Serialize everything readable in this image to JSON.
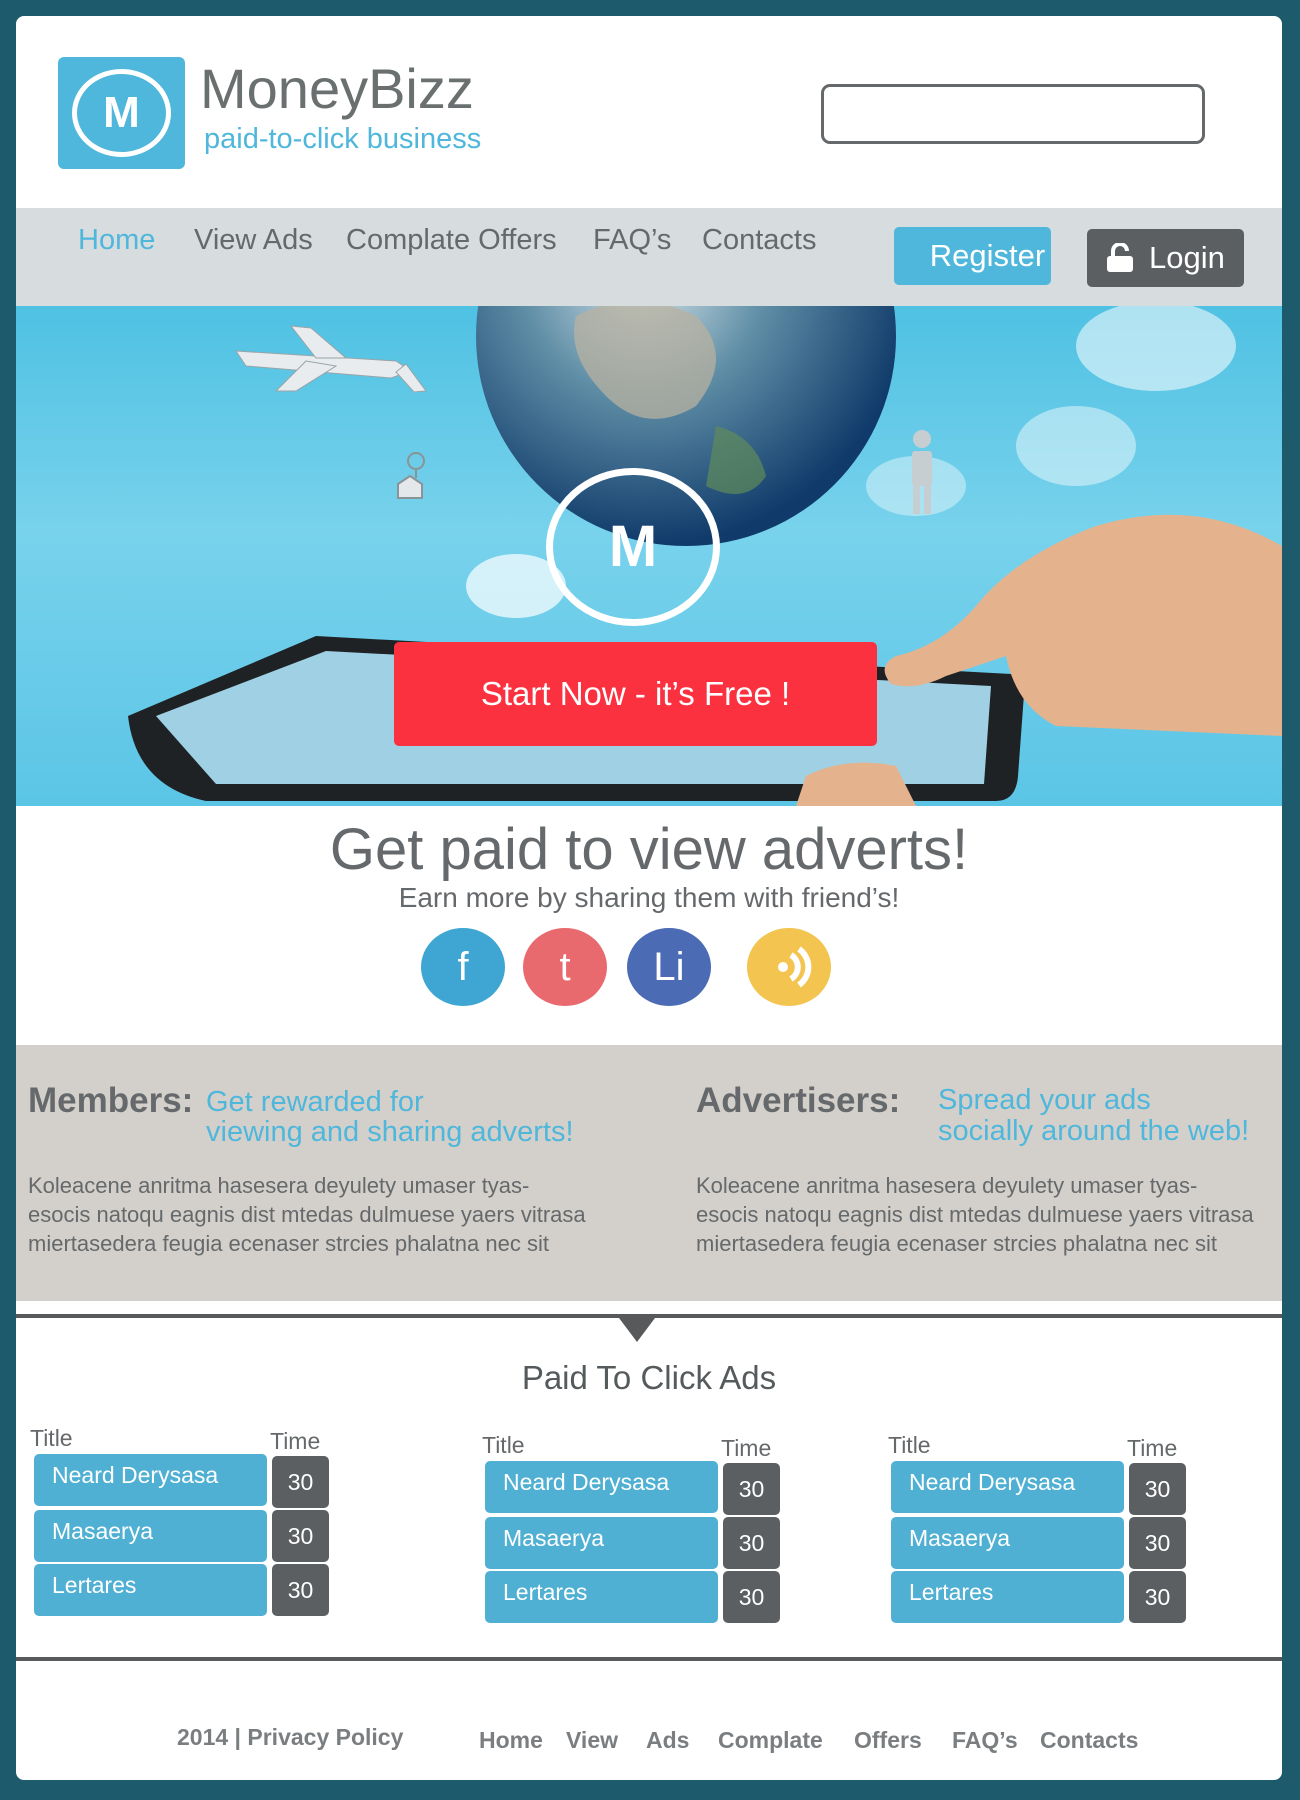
{
  "brand": {
    "logo_letter": "M",
    "name": "MoneyBizz",
    "tagline": "paid-to-click business"
  },
  "search": {
    "value": "",
    "placeholder": ""
  },
  "nav": {
    "items": [
      {
        "label": "Home"
      },
      {
        "label": "View Ads"
      },
      {
        "label": "Complate Offers"
      },
      {
        "label": "FAQ’s"
      },
      {
        "label": "Contacts"
      }
    ],
    "register_label": "Register",
    "login_label": "Login"
  },
  "hero": {
    "ring_letter": "M",
    "cta_label": "Start Now - it’s Free !"
  },
  "intro": {
    "title": "Get paid to view adverts!",
    "subtitle": "Earn more by sharing them with friend’s!",
    "social": [
      {
        "label": "f"
      },
      {
        "label": "t"
      },
      {
        "label": "Li"
      }
    ]
  },
  "members": {
    "heading": "Members:",
    "sub_line1": "Get rewarded for",
    "sub_line2": "viewing and sharing adverts!",
    "body": "Koleacene anritma hasesera deyulety umaser tyas-esocis natoqu eagnis dist mtedas dulmuese yaers vitrasa miertasedera feugia ecenaser strcies phalatna nec sit"
  },
  "advertisers": {
    "heading": "Advertisers:",
    "sub_line1": "Spread your ads",
    "sub_line2": "socially around the web!",
    "body": "Koleacene anritma hasesera deyulety umaser tyas-esocis natoqu eagnis dist mtedas dulmuese yaers vitrasa miertasedera feugia ecenaser strcies phalatna nec sit"
  },
  "ptc": {
    "title": "Paid To Click Ads",
    "columns": [
      {
        "title_label": "Title",
        "time_label": "Time",
        "rows": [
          {
            "title": "Neard Derysasa",
            "time": "30"
          },
          {
            "title": "Masaerya",
            "time": "30"
          },
          {
            "title": "Lertares",
            "time": "30"
          }
        ]
      },
      {
        "title_label": "Title",
        "time_label": "Time",
        "rows": [
          {
            "title": "Neard Derysasa",
            "time": "30"
          },
          {
            "title": "Masaerya",
            "time": "30"
          },
          {
            "title": "Lertares",
            "time": "30"
          }
        ]
      },
      {
        "title_label": "Title",
        "time_label": "Time",
        "rows": [
          {
            "title": "Neard Derysasa",
            "time": "30"
          },
          {
            "title": "Masaerya",
            "time": "30"
          },
          {
            "title": "Lertares",
            "time": "30"
          }
        ]
      }
    ]
  },
  "footer": {
    "copyright": "2014 | Privacy Policy",
    "links": [
      {
        "label": "Home"
      },
      {
        "label": "View"
      },
      {
        "label": "Ads"
      },
      {
        "label": "Complate"
      },
      {
        "label": "Offers"
      },
      {
        "label": "FAQ’s"
      },
      {
        "label": "Contacts"
      }
    ]
  },
  "colors": {
    "accent": "#4fb7db",
    "cta": "#fb3140",
    "dark_button": "#5b5f61",
    "frame": "#1d5a6b",
    "facebook": "#3fa6d3",
    "twitter": "#e96a6e",
    "linkedin": "#4c6bb5",
    "rss": "#f3c44f"
  }
}
